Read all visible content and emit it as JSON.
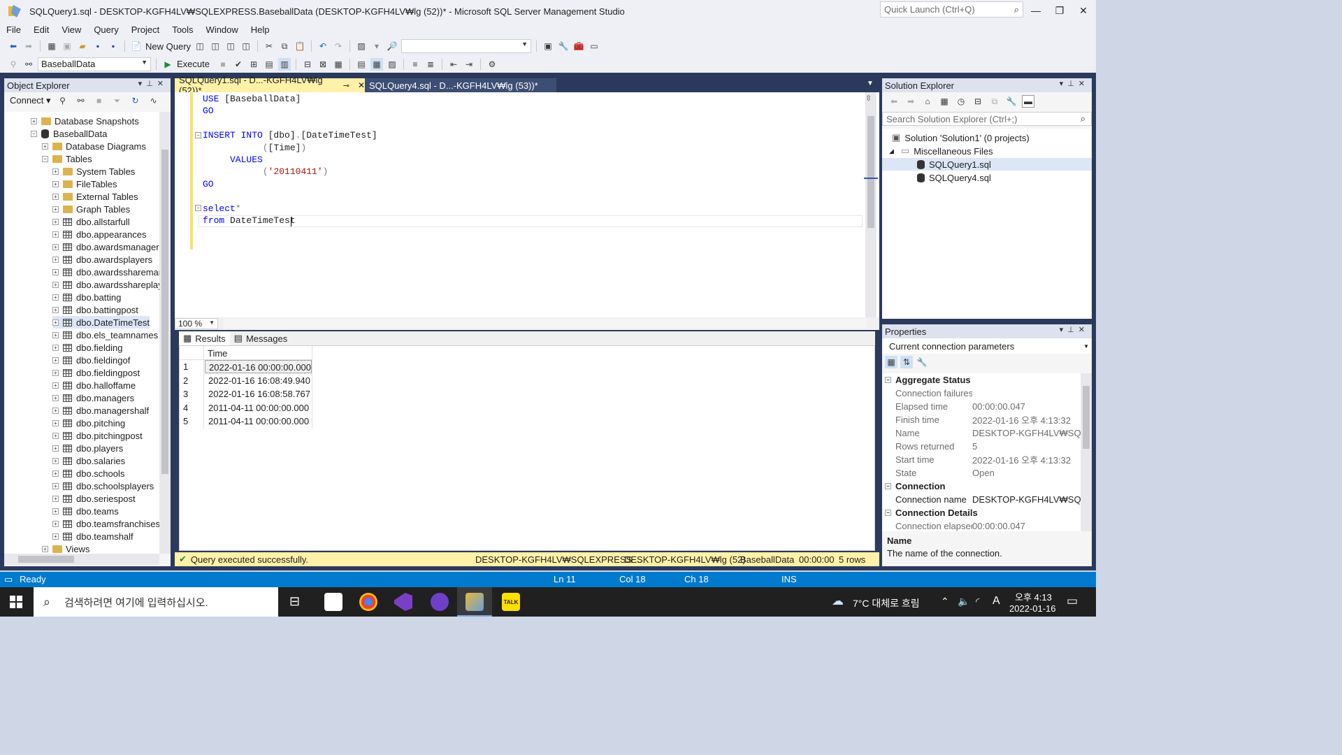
{
  "window": {
    "title": "SQLQuery1.sql - DESKTOP-KGFH4LV₩SQLEXPRESS.BaseballData (DESKTOP-KGFH4LV₩lg (52))* - Microsoft SQL Server Management Studio",
    "quick_launch_placeholder": "Quick Launch (Ctrl+Q)"
  },
  "menu": [
    "File",
    "Edit",
    "View",
    "Query",
    "Project",
    "Tools",
    "Window",
    "Help"
  ],
  "toolbar": {
    "new_query": "New Query",
    "database": "BaseballData",
    "execute": "Execute"
  },
  "object_explorer": {
    "title": "Object Explorer",
    "connect": "Connect",
    "nodes": [
      {
        "label": "Database Snapshots",
        "kind": "folder",
        "level": 2
      },
      {
        "label": "BaseballData",
        "kind": "db",
        "level": 2
      },
      {
        "label": "Database Diagrams",
        "kind": "folder",
        "level": 3
      },
      {
        "label": "Tables",
        "kind": "folder",
        "level": 3
      },
      {
        "label": "System Tables",
        "kind": "folder",
        "level": 4
      },
      {
        "label": "FileTables",
        "kind": "folder",
        "level": 4
      },
      {
        "label": "External Tables",
        "kind": "folder",
        "level": 4
      },
      {
        "label": "Graph Tables",
        "kind": "folder",
        "level": 4
      },
      {
        "label": "dbo.allstarfull",
        "kind": "table",
        "level": 4
      },
      {
        "label": "dbo.appearances",
        "kind": "table",
        "level": 4
      },
      {
        "label": "dbo.awardsmanagers",
        "kind": "table",
        "level": 4
      },
      {
        "label": "dbo.awardsplayers",
        "kind": "table",
        "level": 4
      },
      {
        "label": "dbo.awardssharemana",
        "kind": "table",
        "level": 4
      },
      {
        "label": "dbo.awardsshareplaye",
        "kind": "table",
        "level": 4
      },
      {
        "label": "dbo.batting",
        "kind": "table",
        "level": 4
      },
      {
        "label": "dbo.battingpost",
        "kind": "table",
        "level": 4
      },
      {
        "label": "dbo.DateTimeTest",
        "kind": "table",
        "level": 4
      },
      {
        "label": "dbo.els_teamnames",
        "kind": "table",
        "level": 4
      },
      {
        "label": "dbo.fielding",
        "kind": "table",
        "level": 4
      },
      {
        "label": "dbo.fieldingof",
        "kind": "table",
        "level": 4
      },
      {
        "label": "dbo.fieldingpost",
        "kind": "table",
        "level": 4
      },
      {
        "label": "dbo.halloffame",
        "kind": "table",
        "level": 4
      },
      {
        "label": "dbo.managers",
        "kind": "table",
        "level": 4
      },
      {
        "label": "dbo.managershalf",
        "kind": "table",
        "level": 4
      },
      {
        "label": "dbo.pitching",
        "kind": "table",
        "level": 4
      },
      {
        "label": "dbo.pitchingpost",
        "kind": "table",
        "level": 4
      },
      {
        "label": "dbo.players",
        "kind": "table",
        "level": 4
      },
      {
        "label": "dbo.salaries",
        "kind": "table",
        "level": 4
      },
      {
        "label": "dbo.schools",
        "kind": "table",
        "level": 4
      },
      {
        "label": "dbo.schoolsplayers",
        "kind": "table",
        "level": 4
      },
      {
        "label": "dbo.seriespost",
        "kind": "table",
        "level": 4
      },
      {
        "label": "dbo.teams",
        "kind": "table",
        "level": 4
      },
      {
        "label": "dbo.teamsfranchises",
        "kind": "table",
        "level": 4
      },
      {
        "label": "dbo.teamshalf",
        "kind": "table",
        "level": 4
      },
      {
        "label": "Views",
        "kind": "folder",
        "level": 3
      }
    ]
  },
  "tabs": {
    "active": "SQLQuery1.sql - D...-KGFH4LV₩lg (52))*",
    "second": "SQLQuery4.sql - D...-KGFH4LV₩lg (53))*"
  },
  "editor": {
    "lines": [
      {
        "parts": [
          [
            "kw",
            "USE "
          ],
          [
            "",
            "[BaseballData]"
          ]
        ]
      },
      {
        "parts": [
          [
            "kw",
            "GO"
          ]
        ]
      },
      {
        "parts": []
      },
      {
        "parts": [
          [
            "kw",
            "INSERT INTO "
          ],
          [
            "",
            "[dbo]"
          ],
          [
            "gr",
            "."
          ],
          [
            "",
            "[DateTimeTest]"
          ]
        ]
      },
      {
        "parts": [
          [
            "",
            "           "
          ],
          [
            "gr",
            "("
          ],
          [
            "",
            "[Time]"
          ],
          [
            "gr",
            ")"
          ]
        ]
      },
      {
        "parts": [
          [
            "kw",
            "     VALUES"
          ]
        ]
      },
      {
        "parts": [
          [
            "",
            "           "
          ],
          [
            "gr",
            "("
          ],
          [
            "str",
            "'20110411'"
          ],
          [
            "gr",
            ")"
          ]
        ]
      },
      {
        "parts": [
          [
            "kw",
            "GO"
          ]
        ]
      },
      {
        "parts": []
      },
      {
        "parts": [
          [
            "kw",
            "select"
          ],
          [
            "gr",
            "*"
          ]
        ]
      },
      {
        "parts": [
          [
            "kw",
            "from "
          ],
          [
            "",
            "DateTimeTest"
          ]
        ]
      }
    ],
    "zoom": "100 %"
  },
  "results": {
    "tab_results": "Results",
    "tab_messages": "Messages",
    "column": "Time",
    "rows": [
      {
        "n": "1",
        "time": "2022-01-16 00:00:00.000"
      },
      {
        "n": "2",
        "time": "2022-01-16 16:08:49.940"
      },
      {
        "n": "3",
        "time": "2022-01-16 16:08:58.767"
      },
      {
        "n": "4",
        "time": "2011-04-11 00:00:00.000"
      },
      {
        "n": "5",
        "time": "2011-04-11 00:00:00.000"
      }
    ]
  },
  "query_status": {
    "message": "Query executed successfully.",
    "server": "DESKTOP-KGFH4LV₩SQLEXPRESS ...",
    "user": "DESKTOP-KGFH4LV₩lg (52)",
    "database": "BaseballData",
    "elapsed": "00:00:00",
    "rows": "5 rows"
  },
  "solution_explorer": {
    "title": "Solution Explorer",
    "search_placeholder": "Search Solution Explorer (Ctrl+;)",
    "solution": "Solution 'Solution1' (0 projects)",
    "misc": "Miscellaneous Files",
    "files": [
      "SQLQuery1.sql",
      "SQLQuery4.sql"
    ]
  },
  "properties": {
    "title": "Properties",
    "selector": "Current connection parameters",
    "sections": [
      {
        "name": "Aggregate Status",
        "rows": [
          [
            "Connection failures",
            ""
          ],
          [
            "Elapsed time",
            "00:00:00.047"
          ],
          [
            "Finish time",
            "2022-01-16 오후 4:13:32"
          ],
          [
            "Name",
            "DESKTOP-KGFH4LV₩SQ"
          ],
          [
            "Rows returned",
            "5"
          ],
          [
            "Start time",
            "2022-01-16 오후 4:13:32"
          ],
          [
            "State",
            "Open"
          ]
        ]
      },
      {
        "name": "Connection",
        "rows": [
          [
            "Connection name",
            "DESKTOP-KGFH4LV₩SQ"
          ]
        ]
      },
      {
        "name": "Connection Details",
        "rows": [
          [
            "Connection elapsed ti",
            "00:00:00.047"
          ]
        ]
      }
    ],
    "desc_title": "Name",
    "desc_text": "The name of the connection."
  },
  "statusbar": {
    "ready": "Ready",
    "ln": "Ln 11",
    "col": "Col 18",
    "ch": "Ch 18",
    "ins": "INS"
  },
  "taskbar": {
    "search_placeholder": "검색하려면 여기에 입력하십시오.",
    "weather": "7°C 대체로 흐림",
    "ime": "A",
    "time": "오후 4:13",
    "date": "2022-01-16"
  }
}
